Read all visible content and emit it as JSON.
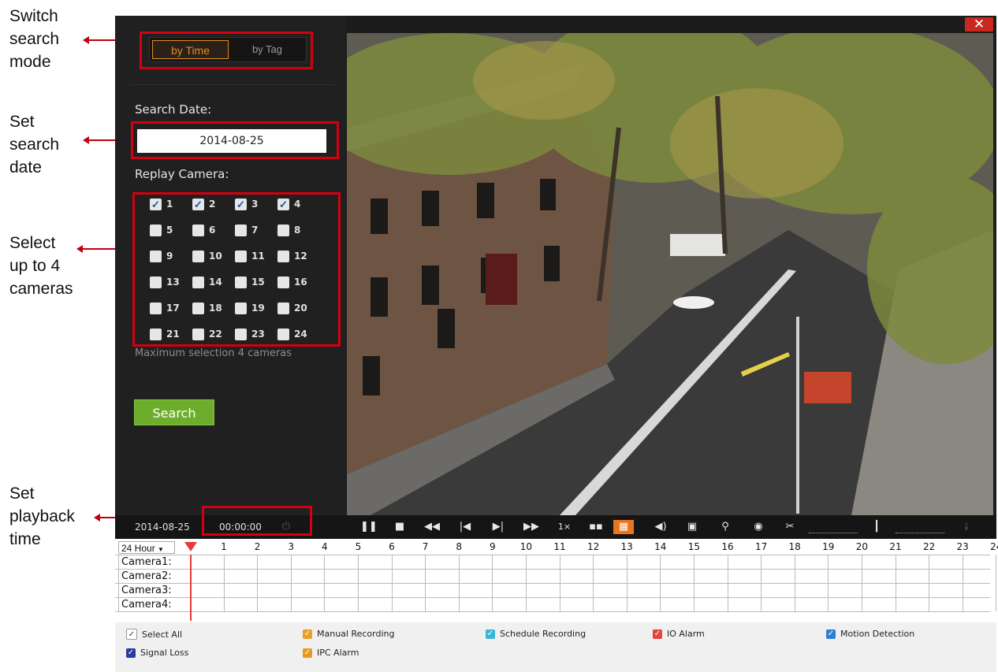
{
  "annotations": {
    "switch_mode": "Switch\nsearch\nmode",
    "set_date": "Set\nsearch\ndate",
    "select_cameras": "Select\nup to 4\ncameras",
    "set_time": "Set\nplayback\ntime"
  },
  "window": {
    "close_icon": "✕"
  },
  "search_mode": {
    "time_label": "by Time",
    "tag_label": "by Tag",
    "active": "by Time"
  },
  "search_date": {
    "label": "Search Date:",
    "value": "2014-08-25"
  },
  "replay_camera": {
    "label": "Replay Camera:",
    "cameras": [
      {
        "num": "1",
        "checked": true
      },
      {
        "num": "2",
        "checked": true
      },
      {
        "num": "3",
        "checked": true
      },
      {
        "num": "4",
        "checked": true
      },
      {
        "num": "5",
        "checked": false
      },
      {
        "num": "6",
        "checked": false
      },
      {
        "num": "7",
        "checked": false
      },
      {
        "num": "8",
        "checked": false
      },
      {
        "num": "9",
        "checked": false
      },
      {
        "num": "10",
        "checked": false
      },
      {
        "num": "11",
        "checked": false
      },
      {
        "num": "12",
        "checked": false
      },
      {
        "num": "13",
        "checked": false
      },
      {
        "num": "14",
        "checked": false
      },
      {
        "num": "15",
        "checked": false
      },
      {
        "num": "16",
        "checked": false
      },
      {
        "num": "17",
        "checked": false
      },
      {
        "num": "18",
        "checked": false
      },
      {
        "num": "19",
        "checked": false
      },
      {
        "num": "20",
        "checked": false
      },
      {
        "num": "21",
        "checked": false
      },
      {
        "num": "22",
        "checked": false
      },
      {
        "num": "23",
        "checked": false
      },
      {
        "num": "24",
        "checked": false
      }
    ],
    "max_note": "Maximum selection 4 cameras"
  },
  "search_button": "Search",
  "control_bar": {
    "date": "2014-08-25",
    "time": "00:00:00",
    "speed": "1×",
    "icons": [
      "pause-icon",
      "stop-icon",
      "rewind-icon",
      "prev-frame-icon",
      "next-frame-icon",
      "fast-forward-icon",
      "speed-label",
      "quad-layout-icon",
      "single-layout-icon",
      "volume-icon",
      "record-clip-icon",
      "tag-pin-icon",
      "snapshot-icon",
      "cut-clip-icon",
      "slider-track",
      "download-icon"
    ]
  },
  "timeline": {
    "range_select": "24 Hour",
    "hours": [
      "1",
      "2",
      "3",
      "4",
      "5",
      "6",
      "7",
      "8",
      "9",
      "10",
      "11",
      "12",
      "13",
      "14",
      "15",
      "16",
      "17",
      "18",
      "19",
      "20",
      "21",
      "22",
      "23",
      "24"
    ],
    "cameras": [
      "Camera1:",
      "Camera2:",
      "Camera3:",
      "Camera4:"
    ]
  },
  "legend": [
    {
      "label": "Select All",
      "color": "#ffffff",
      "checkmark": "✓"
    },
    {
      "label": "Manual Recording",
      "color": "#e6a02a"
    },
    {
      "label": "Schedule Recording",
      "color": "#3cb6d6"
    },
    {
      "label": "IO Alarm",
      "color": "#e0463c"
    },
    {
      "label": "Motion Detection",
      "color": "#2f80d0"
    },
    {
      "label": "Signal Loss",
      "color": "#2b3aa0"
    },
    {
      "label": "IPC Alarm",
      "color": "#e89a1e"
    }
  ]
}
